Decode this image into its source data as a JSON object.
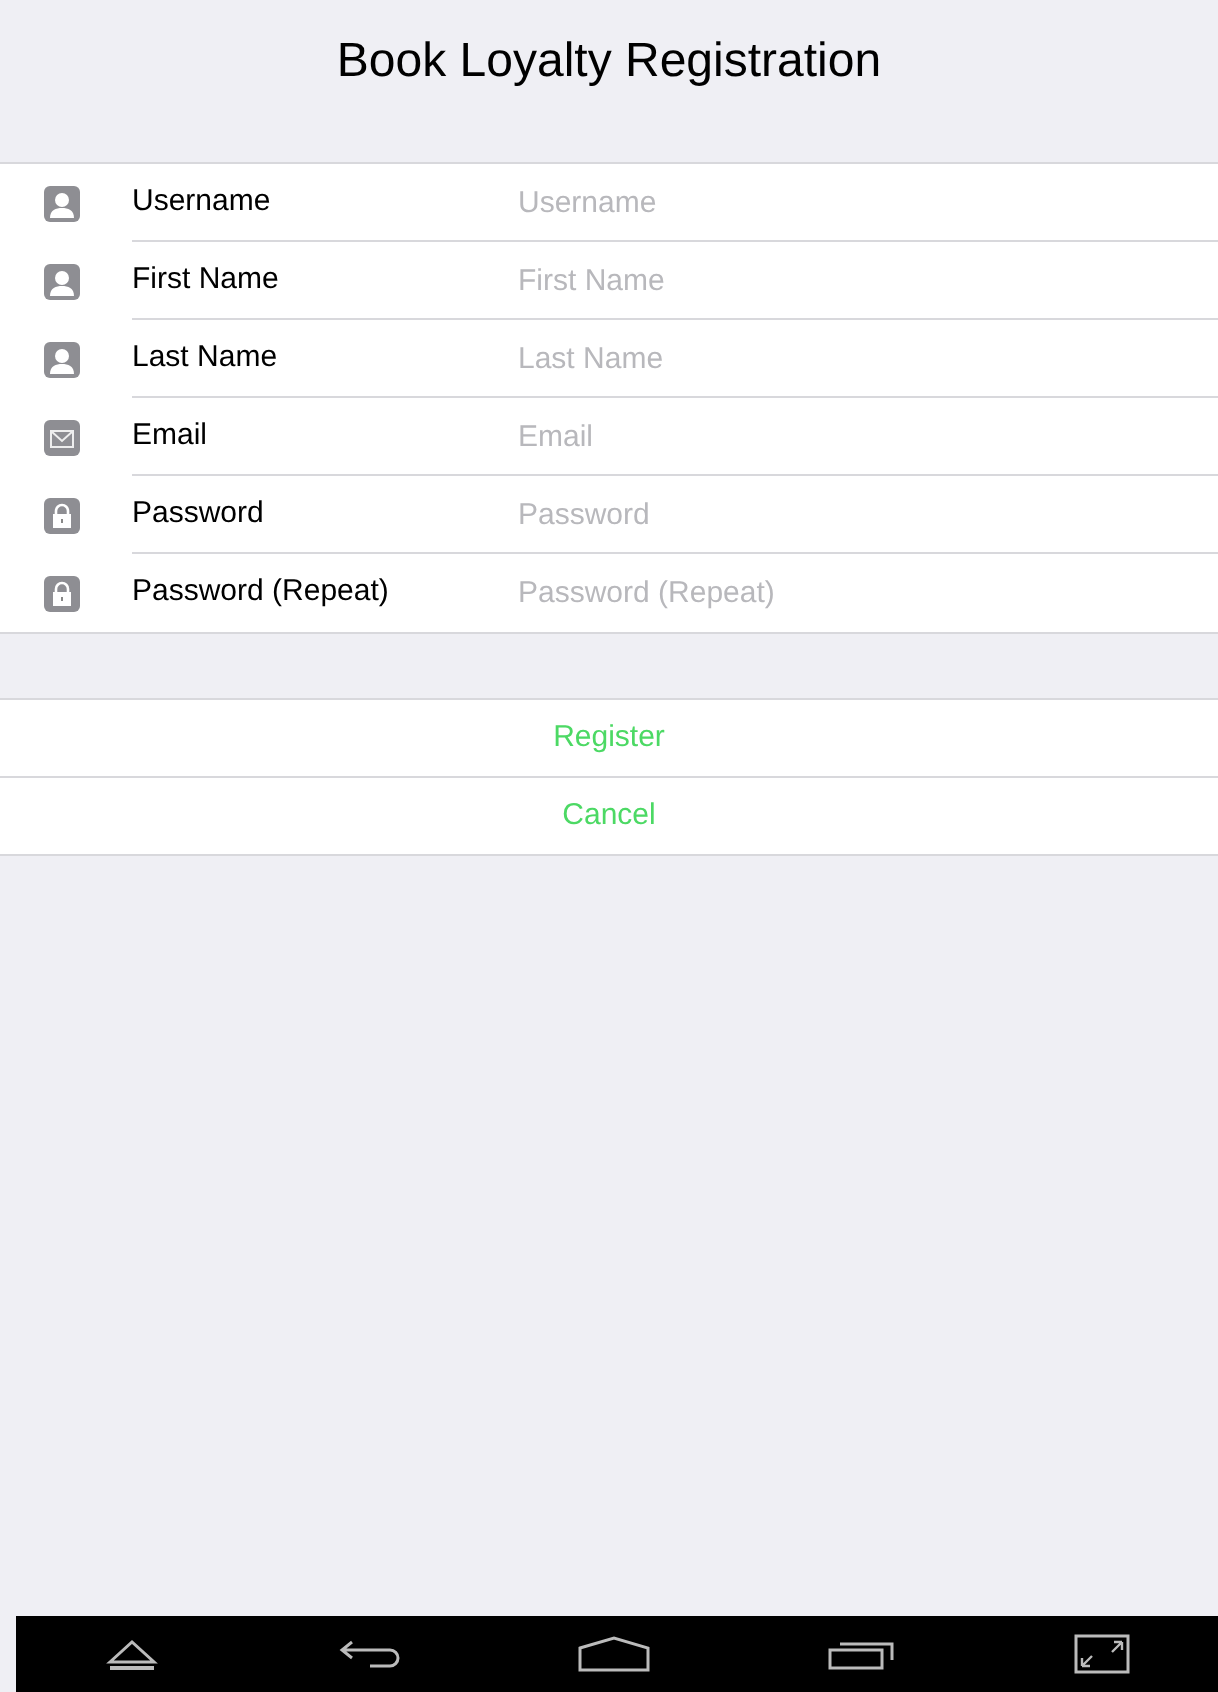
{
  "title": "Book Loyalty Registration",
  "fields": [
    {
      "kind": "person",
      "label": "Username",
      "placeholder": "Username"
    },
    {
      "kind": "person",
      "label": "First Name",
      "placeholder": "First Name"
    },
    {
      "kind": "person",
      "label": "Last Name",
      "placeholder": "Last Name"
    },
    {
      "kind": "mail",
      "label": "Email",
      "placeholder": "Email"
    },
    {
      "kind": "lock",
      "label": "Password",
      "placeholder": "Password"
    },
    {
      "kind": "lock",
      "label": "Password (Repeat)",
      "placeholder": "Password (Repeat)"
    }
  ],
  "buttons": [
    "Register",
    "Cancel"
  ]
}
